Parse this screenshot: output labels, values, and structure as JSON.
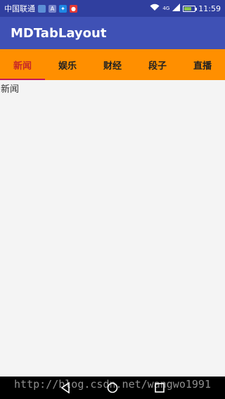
{
  "status_bar": {
    "carrier": "中国联通",
    "network_badge": "4G",
    "time": "11:59",
    "battery_level": 0.7,
    "notification_icons": [
      "app-icon",
      "a-icon",
      "bird-icon",
      "red-app-icon"
    ]
  },
  "app_bar": {
    "title": "MDTabLayout"
  },
  "tabs": [
    {
      "label": "新闻",
      "active": true
    },
    {
      "label": "娱乐",
      "active": false
    },
    {
      "label": "财经",
      "active": false
    },
    {
      "label": "段子",
      "active": false
    },
    {
      "label": "直播",
      "active": false
    }
  ],
  "content": {
    "text": "新闻"
  },
  "watermark": "http://blog.csdn.net/wangwo1991",
  "colors": {
    "status_bar": "#303f9f",
    "app_bar": "#3f51b5",
    "tab_bar": "#ff8f00",
    "tab_indicator": "#c2185b",
    "active_tab_text": "#c62828"
  }
}
